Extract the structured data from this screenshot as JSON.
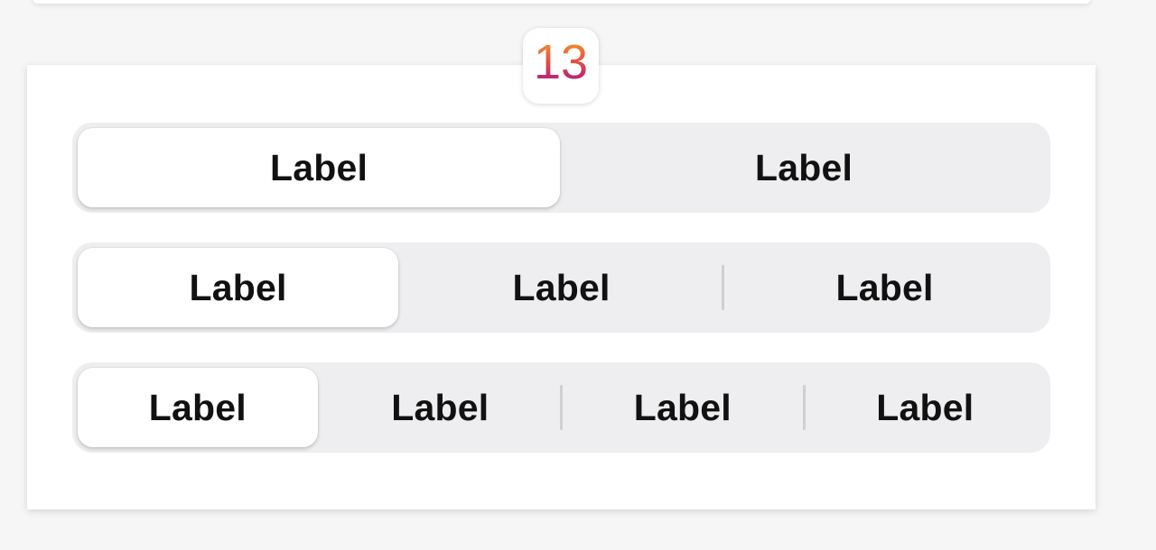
{
  "version_badge": {
    "text": "13",
    "gradient": [
      "#f7a72b",
      "#e8543a",
      "#c12b6e",
      "#7a2a8f"
    ]
  },
  "segmented_controls": [
    {
      "segments": [
        "Label",
        "Label"
      ],
      "selected_index": 0
    },
    {
      "segments": [
        "Label",
        "Label",
        "Label"
      ],
      "selected_index": 0
    },
    {
      "segments": [
        "Label",
        "Label",
        "Label",
        "Label"
      ],
      "selected_index": 0
    }
  ],
  "colors": {
    "track": "#eeeef0",
    "selected": "#ffffff",
    "text": "#111111",
    "divider": "#cfcfd3"
  }
}
